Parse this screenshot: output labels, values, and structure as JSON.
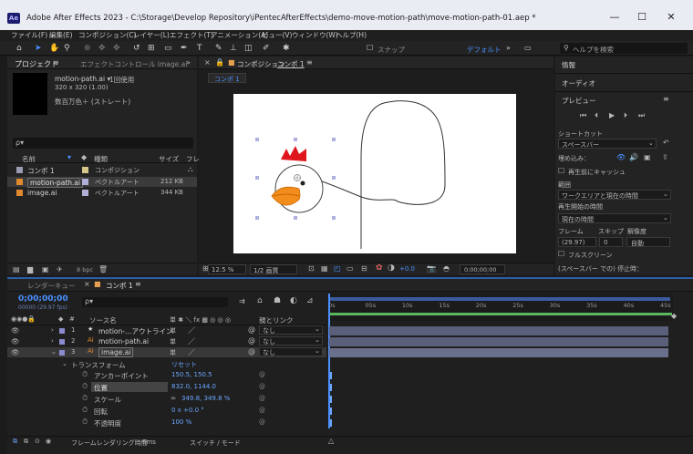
{
  "window": {
    "app_icon": "Ae",
    "title": "Adobe After Effects 2023 - C:\\Storage\\Develop Repository\\iPentecAfterEffects\\demo-move-motion-path\\move-motion-path-01.aep *",
    "minimize": "—",
    "maximize": "☐",
    "close": "✕"
  },
  "menu": [
    "ファイル(F)",
    "編集(E)",
    "コンポジション(C)",
    "レイヤー(L)",
    "エフェクト(T)",
    "アニメーション(A)",
    "ビュー(V)",
    "ウィンドウ(W)",
    "ヘルプ(H)"
  ],
  "toolbar": {
    "snap_label": "スナップ",
    "workspace": "デフォルト",
    "search_placeholder": "ヘルプを検索",
    "workspace_more": "»"
  },
  "project": {
    "tab": "プロジェクト",
    "tab_menu": "≡",
    "effects_tab": "エフェクトコントロール image.ai",
    "more": "»",
    "item_name": "motion-path.ai ▾",
    "item_usage": "1回使用",
    "item_size": "320 x 320 (1.00)",
    "item_color": "数百万色＋ (ストレート)",
    "search_icon_label": "ρ▾",
    "columns": {
      "name": "名前",
      "type": "種類",
      "size": "サイズ",
      "fl": "フレ"
    },
    "items": [
      {
        "name": "コンポ 1",
        "type": "コンポジション",
        "size": ""
      },
      {
        "name": "motion-path.ai",
        "type": "ベクトルアート",
        "size": "212 KB"
      },
      {
        "name": "image.ai",
        "type": "ベクトルアート",
        "size": "344 KB"
      }
    ],
    "bpc": "8 bpc"
  },
  "composition": {
    "tab_prefix": "コンポジション",
    "tab_name": "コンポ 1",
    "sub_tab": "コンポ 1",
    "menu": "≡",
    "zoom": "12.5 %",
    "resolution": "1/2 画質",
    "exposure": "+0.0",
    "timecode": "0;00;00;00"
  },
  "right": {
    "info": "情報",
    "audio": "オーディオ",
    "preview": "プレビュー",
    "menu": "≡",
    "shortcut_label": "ショートカット",
    "shortcut_value": "スペースバー",
    "include_label": "埋め込み：",
    "cache_label": "再生前にキャッシュ",
    "range_label": "範囲",
    "range_value": "ワークエリアと現在の時間",
    "start_label": "再生開始の時間",
    "start_value": "現在の時間",
    "frame_label": "フレーム",
    "skip_label": "スキップ",
    "res_label": "解像度",
    "frame_value": "(29.97)",
    "skip_value": "0",
    "res_value": "自動",
    "fullscreen_label": "フルスクリーン",
    "footer": "(スペースバー での) 停止時："
  },
  "timeline": {
    "render_tab": "レンダーキュー",
    "comp_tab": "コンポ 1",
    "menu": "≡",
    "timecode": "0;00;00;00",
    "fps": "00000 (29.97 fps)",
    "search_placeholder": "ρ▾",
    "col_source": "ソース名",
    "col_switches": "単 ✱ ＼ fx ▩ ◎ ◎ ◎",
    "col_parent": "親とリンク",
    "ruler": [
      "0s",
      "05s",
      "10s",
      "15s",
      "20s",
      "25s",
      "30s",
      "35s",
      "40s",
      "45s"
    ],
    "layers": [
      {
        "num": "1",
        "icon": "★",
        "name": "motion-…アウトライン",
        "switch": "単",
        "parent": "なし"
      },
      {
        "num": "2",
        "icon": "Ai",
        "name": "motion-path.ai",
        "switch": "単",
        "parent": "なし"
      },
      {
        "num": "3",
        "icon": "Ai",
        "name": "image.ai",
        "switch": "単",
        "parent": "なし"
      }
    ],
    "transform": "トランスフォーム",
    "reset": "リセット",
    "props": [
      {
        "name": "アンカーポイント",
        "value": "150.5, 150.5"
      },
      {
        "name": "位置",
        "value": "832.0, 1144.0"
      },
      {
        "name": "スケール",
        "value": "349.8, 349.8 %"
      },
      {
        "name": "回転",
        "value": "0 x +0.0 °"
      },
      {
        "name": "不透明度",
        "value": "100 %"
      }
    ],
    "footer_render": "フレームレンダリング時間",
    "footer_time": "6ms",
    "footer_switch": "スイッチ / モード"
  }
}
